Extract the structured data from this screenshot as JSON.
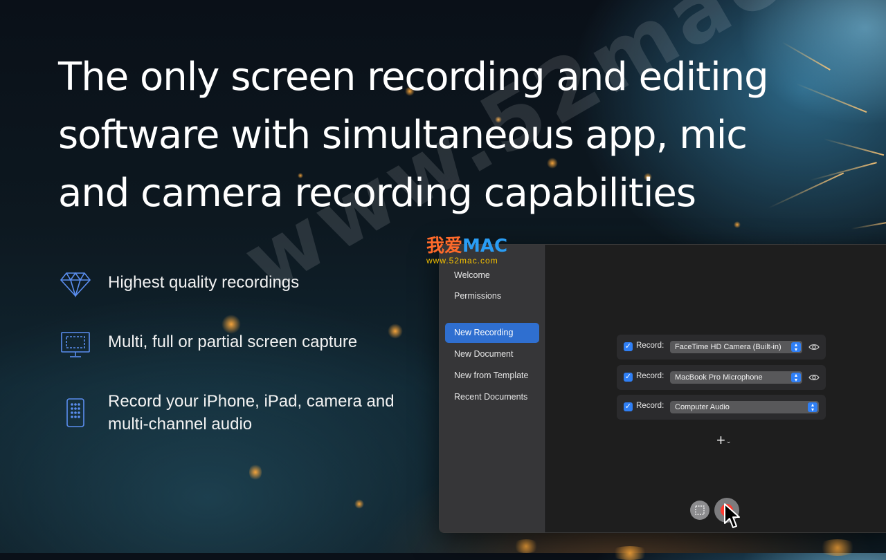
{
  "headline": "The only screen recording and editing software with simultaneous app, mic and camera recording capabilities",
  "features": [
    {
      "icon": "diamond-icon",
      "text": "Highest quality recordings"
    },
    {
      "icon": "monitor-icon",
      "text": "Multi, full or partial screen capture"
    },
    {
      "icon": "phone-icon",
      "text": "Record your iPhone, iPad, camera and multi-channel audio"
    }
  ],
  "watermark": {
    "text": "www.52mac.com",
    "logo_cn": "我爱",
    "logo_mac": "MAC",
    "logo_url": "www.52mac.com"
  },
  "app": {
    "sidebar": {
      "items": [
        {
          "label": "Welcome",
          "active": false
        },
        {
          "label": "Permissions",
          "active": false
        },
        {
          "label": "New Recording",
          "active": true
        },
        {
          "label": "New Document",
          "active": false
        },
        {
          "label": "New from Template",
          "active": false
        },
        {
          "label": "Recent Documents",
          "active": false
        }
      ]
    },
    "sources": [
      {
        "checked": true,
        "label": "Record:",
        "value": "FaceTime HD Camera (Built-in)",
        "has_preview": true
      },
      {
        "checked": true,
        "label": "Record:",
        "value": "MacBook Pro Microphone",
        "has_preview": true
      },
      {
        "checked": true,
        "label": "Record:",
        "value": "Computer Audio",
        "has_preview": false
      }
    ],
    "add_source_label": "+",
    "accent_color": "#2f6fd0",
    "record_color": "#ff3b30"
  }
}
